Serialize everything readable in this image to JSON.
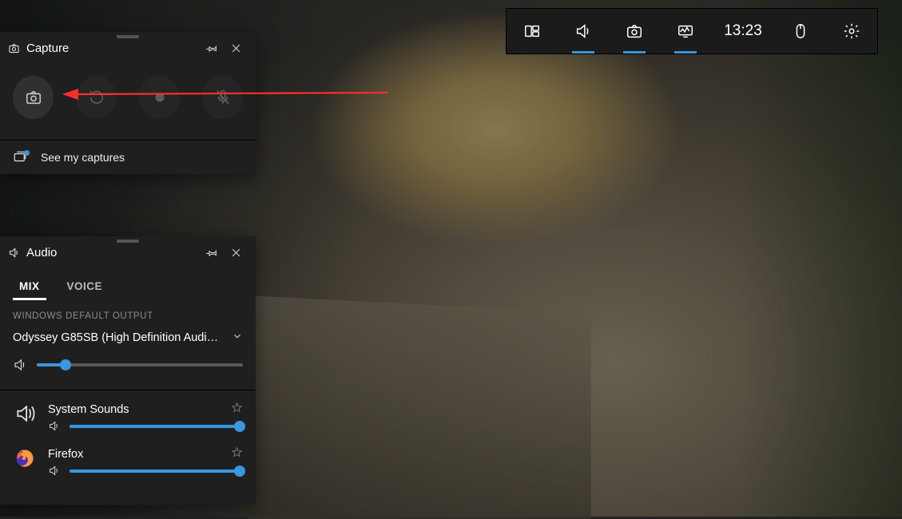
{
  "topbar": {
    "clock": "13:23"
  },
  "capture": {
    "title": "Capture",
    "see_captures": "See my captures"
  },
  "audio": {
    "title": "Audio",
    "tabs": {
      "mix": "MIX",
      "voice": "VOICE"
    },
    "section_default_output": "WINDOWS DEFAULT OUTPUT",
    "device": "Odyssey G85SB (High Definition Audio D…",
    "master_volume_pct": 14,
    "apps": [
      {
        "name": "System Sounds",
        "volume_pct": 100,
        "icon": "speaker"
      },
      {
        "name": "Firefox",
        "volume_pct": 100,
        "icon": "firefox"
      }
    ]
  },
  "colors": {
    "accent": "#3a96dd"
  }
}
